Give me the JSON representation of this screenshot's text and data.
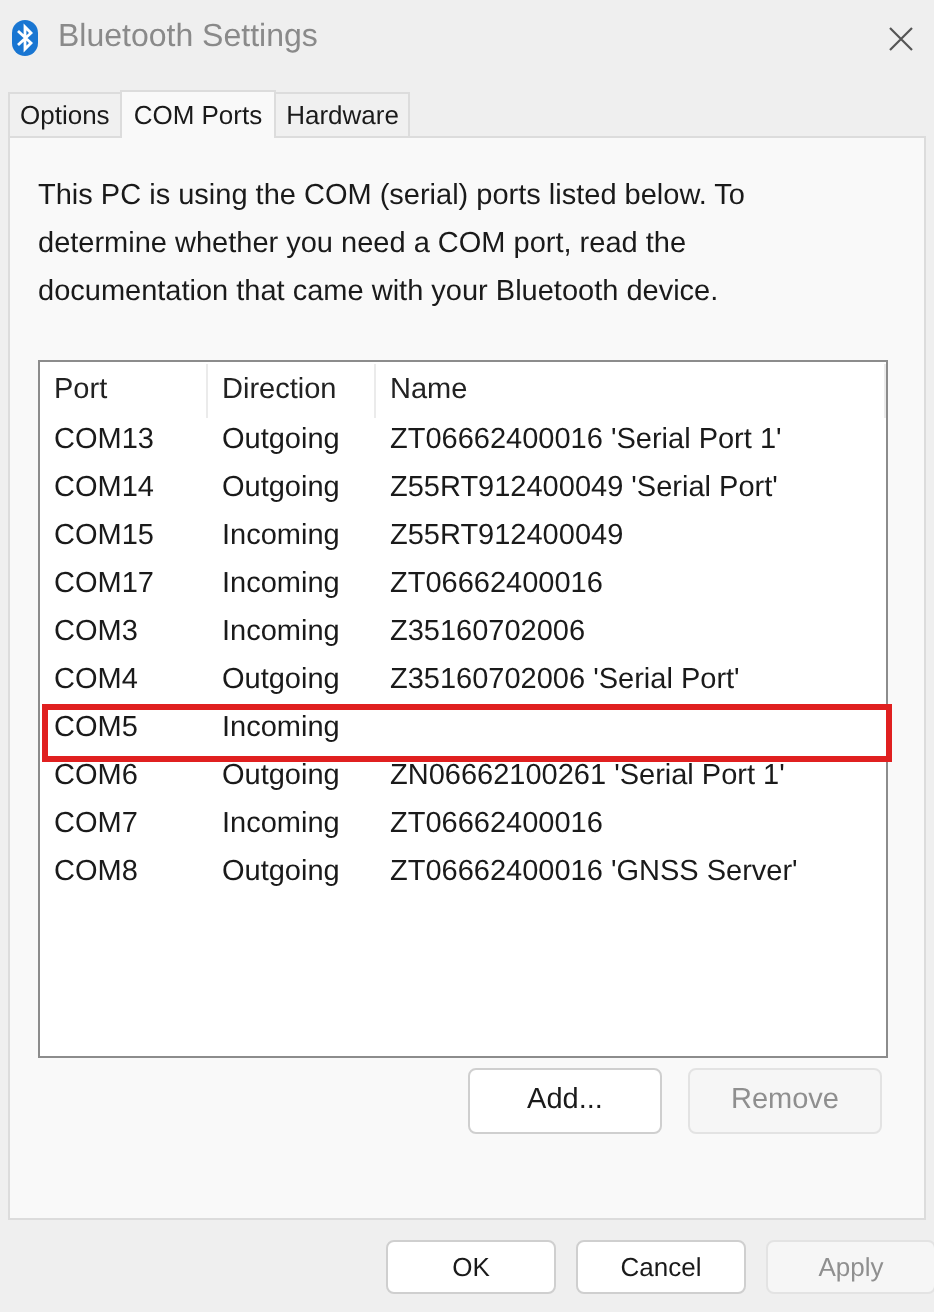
{
  "window": {
    "title": "Bluetooth Settings"
  },
  "tabs": [
    {
      "label": "Options",
      "selected": false
    },
    {
      "label": "COM Ports",
      "selected": true
    },
    {
      "label": "Hardware",
      "selected": false
    }
  ],
  "description": "This PC is using the COM (serial) ports listed below. To determine whether you need a COM port, read the documentation that came with your Bluetooth device.",
  "table": {
    "columns": [
      "Port",
      "Direction",
      "Name"
    ],
    "rows": [
      {
        "port": "COM13",
        "direction": "Outgoing",
        "name": "ZT06662400016 'Serial Port 1'",
        "highlighted": false
      },
      {
        "port": "COM14",
        "direction": "Outgoing",
        "name": "Z55RT912400049 'Serial Port'",
        "highlighted": false
      },
      {
        "port": "COM15",
        "direction": "Incoming",
        "name": "Z55RT912400049",
        "highlighted": false
      },
      {
        "port": "COM17",
        "direction": "Incoming",
        "name": "ZT06662400016",
        "highlighted": false
      },
      {
        "port": "COM3",
        "direction": "Incoming",
        "name": "Z35160702006",
        "highlighted": false
      },
      {
        "port": "COM4",
        "direction": "Outgoing",
        "name": "Z35160702006 'Serial Port'",
        "highlighted": false
      },
      {
        "port": "COM5",
        "direction": "Incoming",
        "highlighted": true
      },
      {
        "port": "COM6",
        "direction": "Outgoing",
        "name": "ZN06662100261 'Serial Port 1'",
        "highlighted": false
      },
      {
        "port": "COM7",
        "direction": "Incoming",
        "name": "ZT06662400016",
        "highlighted": false
      },
      {
        "port": "COM8",
        "direction": "Outgoing",
        "name": "ZT06662400016 'GNSS Server'",
        "highlighted": false
      }
    ]
  },
  "list_buttons": [
    {
      "label": "Add...",
      "disabled": false
    },
    {
      "label": "Remove",
      "disabled": true
    }
  ],
  "dialog_buttons": [
    {
      "label": "OK",
      "disabled": false
    },
    {
      "label": "Cancel",
      "disabled": false
    },
    {
      "label": "Apply",
      "disabled": true
    }
  ]
}
